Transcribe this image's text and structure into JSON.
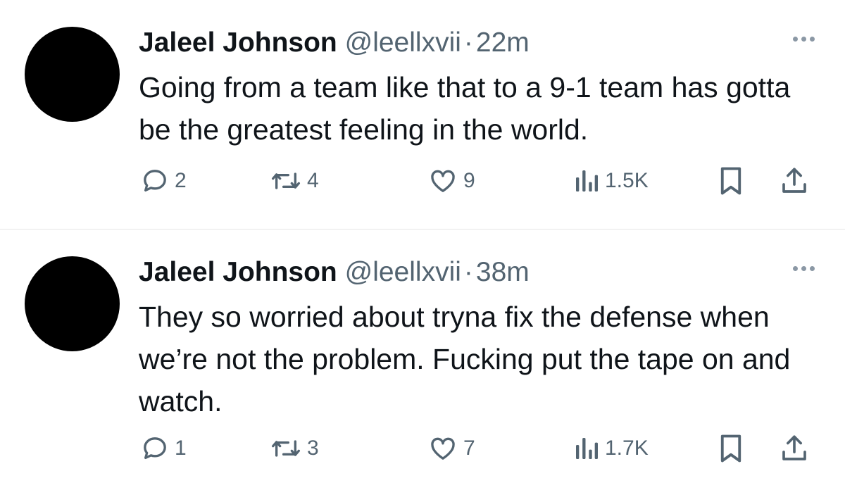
{
  "tweets": [
    {
      "name": "Jaleel Johnson",
      "handle": "@leellxvii",
      "separator": "·",
      "time": "22m",
      "text": "Going from a team like that to a 9-1 team has gotta be the greatest feeling in the world.",
      "replies": "2",
      "retweets": "4",
      "likes": "9",
      "views": "1.5K"
    },
    {
      "name": "Jaleel Johnson",
      "handle": "@leellxvii",
      "separator": "·",
      "time": "38m",
      "text": "They so worried about tryna fix the defense when we’re not the problem. Fucking put the tape on and watch.",
      "replies": "1",
      "retweets": "3",
      "likes": "7",
      "views": "1.7K"
    }
  ],
  "colors": {
    "text": "#0f1419",
    "secondary": "#536471",
    "divider": "#e6e6e6"
  },
  "icons": [
    "reply-icon",
    "retweet-icon",
    "like-icon",
    "views-icon",
    "bookmark-icon",
    "share-icon",
    "more-icon"
  ]
}
